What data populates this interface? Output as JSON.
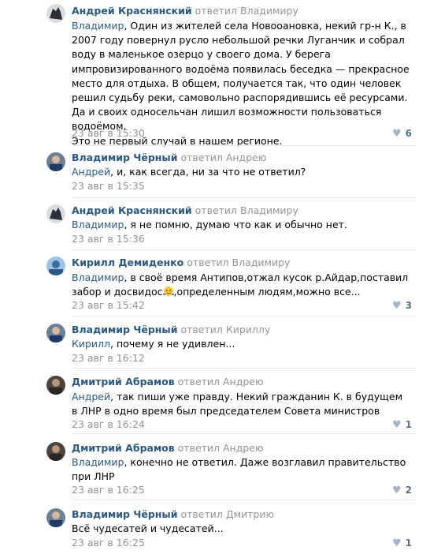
{
  "comments": [
    {
      "author": "Андрей Краснянский",
      "replied": "ответил Владимиру",
      "mention": "Владимир",
      "text": ", Один из жителей села Новооановка, некий гр-н К., в 2007 году повернул русло небольшой речки Луганчик и собрал воду в маленькое озерцо у своего дома. У берега импровизированного водоёма появилась беседка — прекрасное место для отдыха. В общем, получается так, что один человек решил судьбу реки, самовольно распорядившись её ресурсами. Да и своих односельчан лишил возможности пользоваться водоёмом.",
      "text2": "Это не первый случай в нашем регионе.",
      "date": "23 авг в 15:30",
      "likes": "6"
    },
    {
      "author": "Владимир Чёрный",
      "replied": "ответил Андрею",
      "mention": "Андрей",
      "text": ", и, как всегда, ни за что не ответил?",
      "date": "23 авг в 15:35",
      "likes": ""
    },
    {
      "author": "Андрей Краснянский",
      "replied": "ответил Владимиру",
      "mention": "Владимир",
      "text": ", я не помню, думаю что как и обычно нет.",
      "date": "23 авг в 15:36",
      "likes": ""
    },
    {
      "author": "Кирилл Демиденко",
      "replied": "ответил Владимиру",
      "mention": "Владимир",
      "text": ", в своё время Антипов,отжал кусок р.Айдар,поставил забор и досвидос",
      "text_after_emoji": ",определенным людям,можно все...",
      "date": "23 авг в 15:42",
      "likes": "3"
    },
    {
      "author": "Владимир Чёрный",
      "replied": "ответил Кириллу",
      "mention": "Кирилл",
      "text": ", почему я не удивлен...",
      "date": "23 авг в 16:12",
      "likes": ""
    },
    {
      "author": "Дмитрий Абрамов",
      "replied": "ответил Андрею",
      "mention": "Андрей",
      "text": ", так пиши уже правду. Некий гражданин К. в будущем в ЛНР в одно время был председателем Совета министров",
      "date": "23 авг в 16:24",
      "likes": "1"
    },
    {
      "author": "Дмитрий Абрамов",
      "replied": "ответил Андрею",
      "mention": "Владимир",
      "text": ", конечно не ответил. Даже возглавил правительство при ЛНР",
      "date": "23 авг в 16:25",
      "likes": "2"
    },
    {
      "author": "Владимир Чёрный",
      "replied": "ответил Дмитрию",
      "mention": "",
      "text": "Всё чудесатей и чудесатей...",
      "date": "23 авг в 16:25",
      "likes": "1"
    }
  ],
  "colors": {
    "link": "#2a5885",
    "meta": "#939393",
    "like_icon": "#a5b4c6",
    "divider": "#e7e8ec"
  },
  "icons": {
    "like": "heart-icon",
    "emoji": "shrug-emoji-icon"
  }
}
